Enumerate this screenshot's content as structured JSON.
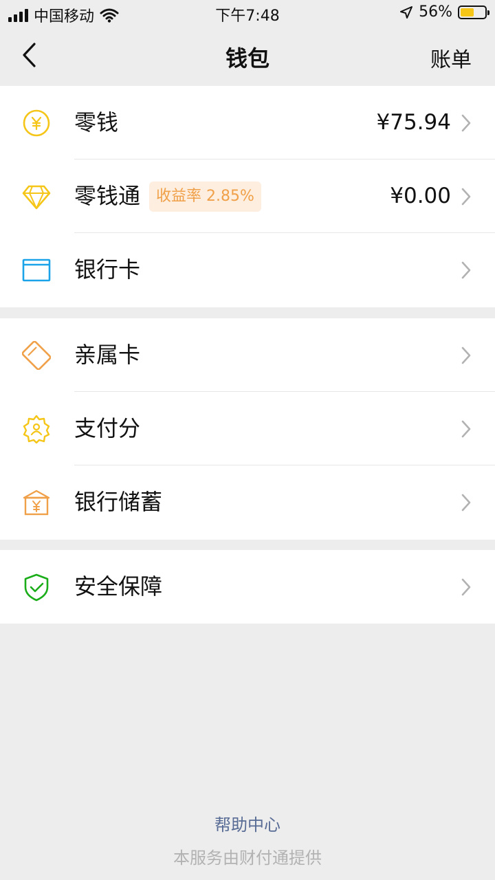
{
  "status_bar": {
    "carrier": "中国移动",
    "time": "下午7:48",
    "battery": "56%"
  },
  "nav": {
    "title": "钱包",
    "right_label": "账单"
  },
  "groups": [
    {
      "items": [
        {
          "label": "零钱",
          "value": "¥75.94",
          "icon": "yuan-coin-icon"
        },
        {
          "label": "零钱通",
          "badge": "收益率 2.85%",
          "value": "¥0.00",
          "icon": "diamond-icon"
        },
        {
          "label": "银行卡",
          "icon": "bank-card-icon"
        }
      ]
    },
    {
      "items": [
        {
          "label": "亲属卡",
          "icon": "family-card-icon"
        },
        {
          "label": "支付分",
          "icon": "pay-score-badge-icon"
        },
        {
          "label": "银行储蓄",
          "icon": "bank-savings-icon"
        }
      ]
    },
    {
      "items": [
        {
          "label": "安全保障",
          "icon": "shield-check-icon"
        }
      ]
    }
  ],
  "footer": {
    "help_link": "帮助中心",
    "provider_note": "本服务由财付通提供"
  },
  "colors": {
    "background": "#ededed",
    "card": "#ffffff",
    "yellow_icon": "#f5c518",
    "orange_icon": "#f0a048",
    "blue_icon": "#1aa3e8",
    "green_icon": "#1aad19",
    "link": "#576b95",
    "badge_bg": "#fdeee0",
    "badge_text": "#f0a048"
  }
}
